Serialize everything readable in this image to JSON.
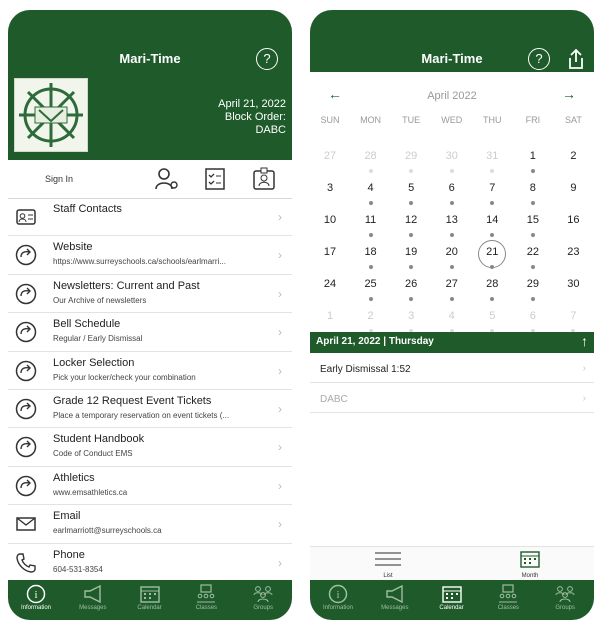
{
  "left": {
    "title": "Mari-Time",
    "help_glyph": "?",
    "banner": {
      "date": "April 21, 2022",
      "block_label": "Block Order:",
      "block_value": "DABC"
    },
    "sign_in": "Sign In",
    "icons": [
      "person-key-icon",
      "checklist-icon",
      "badge-icon"
    ],
    "items": [
      {
        "icon": "contacts-icon",
        "title": "Staff Contacts",
        "sub": ""
      },
      {
        "icon": "link-arrow-icon",
        "title": "Website",
        "sub": "https://www.surreyschools.ca/schools/earlmarri..."
      },
      {
        "icon": "link-arrow-icon",
        "title": "Newsletters: Current and Past",
        "sub": "Our Archive of newsletters"
      },
      {
        "icon": "link-arrow-icon",
        "title": "Bell Schedule",
        "sub": "Regular / Early Dismissal"
      },
      {
        "icon": "link-arrow-icon",
        "title": "Locker Selection",
        "sub": "Pick your locker/check your combination"
      },
      {
        "icon": "link-arrow-icon",
        "title": "Grade 12 Request Event Tickets",
        "sub": "Place a temporary reservation on event tickets (..."
      },
      {
        "icon": "link-arrow-icon",
        "title": "Student Handbook",
        "sub": "Code of Conduct EMS"
      },
      {
        "icon": "link-arrow-icon",
        "title": "Athletics",
        "sub": "www.emsathletics.ca"
      },
      {
        "icon": "mail-icon",
        "title": "Email",
        "sub": "earlmarriott@surreyschools.ca"
      },
      {
        "icon": "phone-icon",
        "title": "Phone",
        "sub": "604-531-8354"
      }
    ],
    "chevron": "›",
    "tabs": [
      {
        "label": "Information",
        "icon": "info-icon",
        "active": true
      },
      {
        "label": "Messages",
        "icon": "megaphone-icon",
        "active": false
      },
      {
        "label": "Calendar",
        "icon": "calendar-icon",
        "active": false
      },
      {
        "label": "Classes",
        "icon": "classes-icon",
        "active": false
      },
      {
        "label": "Groups",
        "icon": "groups-icon",
        "active": false
      }
    ]
  },
  "right": {
    "title": "Mari-Time",
    "help_glyph": "?",
    "month": "April 2022",
    "prev_arrow": "←",
    "next_arrow": "→",
    "dows": [
      "SUN",
      "MON",
      "TUE",
      "WED",
      "THU",
      "FRI",
      "SAT"
    ],
    "weeks": [
      [
        [
          "27",
          1,
          0
        ],
        [
          "28",
          1,
          1
        ],
        [
          "29",
          1,
          1
        ],
        [
          "30",
          1,
          1
        ],
        [
          "31",
          1,
          1
        ],
        [
          "1",
          0,
          1
        ],
        [
          "2",
          0,
          0
        ]
      ],
      [
        [
          "3",
          0,
          0
        ],
        [
          "4",
          0,
          1
        ],
        [
          "5",
          0,
          1
        ],
        [
          "6",
          0,
          1
        ],
        [
          "7",
          0,
          1
        ],
        [
          "8",
          0,
          1
        ],
        [
          "9",
          0,
          0
        ]
      ],
      [
        [
          "10",
          0,
          0
        ],
        [
          "11",
          0,
          1
        ],
        [
          "12",
          0,
          1
        ],
        [
          "13",
          0,
          1
        ],
        [
          "14",
          0,
          1
        ],
        [
          "15",
          0,
          1
        ],
        [
          "16",
          0,
          0
        ]
      ],
      [
        [
          "17",
          0,
          0
        ],
        [
          "18",
          0,
          1
        ],
        [
          "19",
          0,
          1
        ],
        [
          "20",
          0,
          1
        ],
        [
          "21",
          0,
          1
        ],
        [
          "22",
          0,
          1
        ],
        [
          "23",
          0,
          0
        ]
      ],
      [
        [
          "24",
          0,
          0
        ],
        [
          "25",
          0,
          1
        ],
        [
          "26",
          0,
          1
        ],
        [
          "27",
          0,
          1
        ],
        [
          "28",
          0,
          1
        ],
        [
          "29",
          0,
          1
        ],
        [
          "30",
          0,
          0
        ]
      ],
      [
        [
          "1",
          1,
          0
        ],
        [
          "2",
          1,
          1
        ],
        [
          "3",
          1,
          1
        ],
        [
          "4",
          1,
          1
        ],
        [
          "5",
          1,
          1
        ],
        [
          "6",
          1,
          1
        ],
        [
          "7",
          1,
          1
        ]
      ]
    ],
    "selected_day": "21",
    "date_bar": "April 21, 2022 | Thursday",
    "up_arrow": "↑",
    "events": [
      {
        "text": "Early Dismissal 1:52",
        "dim": false
      },
      {
        "text": "DABC",
        "dim": true
      }
    ],
    "switch": {
      "list": "List",
      "month": "Month"
    },
    "tabs": [
      {
        "label": "Information",
        "icon": "info-icon",
        "active": false
      },
      {
        "label": "Messages",
        "icon": "megaphone-icon",
        "active": false
      },
      {
        "label": "Calendar",
        "icon": "calendar-icon",
        "active": true
      },
      {
        "label": "Classes",
        "icon": "classes-icon",
        "active": false
      },
      {
        "label": "Groups",
        "icon": "groups-icon",
        "active": false
      }
    ]
  },
  "colors": {
    "brand_green": "#1f5a2a",
    "tab_inactive": "#9fbfa3"
  }
}
